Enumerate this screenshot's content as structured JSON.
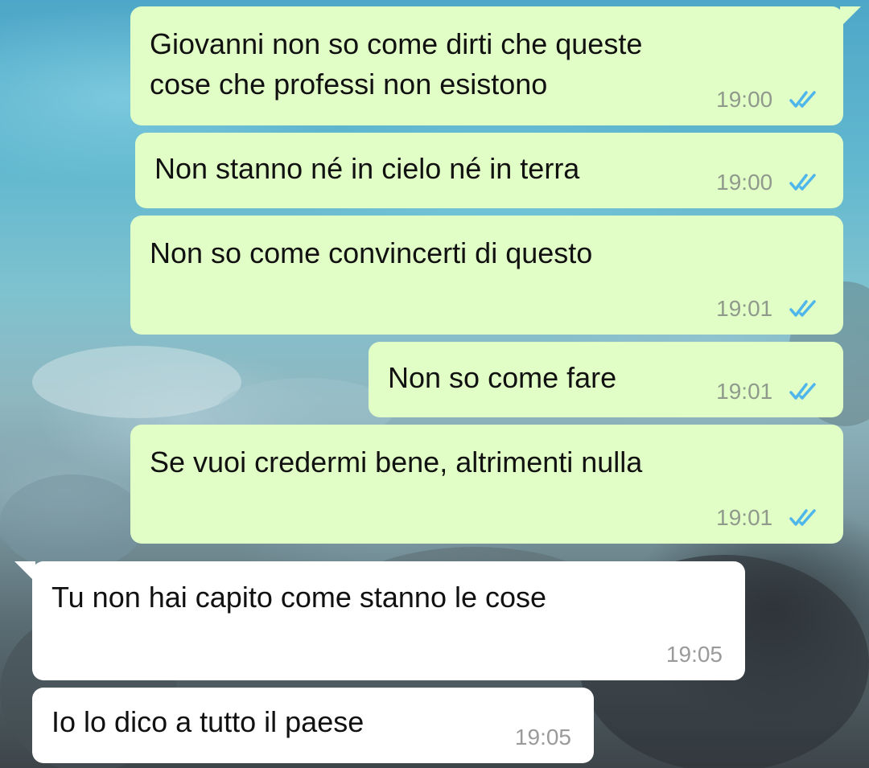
{
  "messages": [
    {
      "text": "Giovanni non so come dirti che queste\ncose che professi non esistono",
      "time": "19:00",
      "direction": "outgoing",
      "status": "read"
    },
    {
      "text": "Non stanno né in cielo né in terra",
      "time": "19:00",
      "direction": "outgoing",
      "status": "read"
    },
    {
      "text": "Non so come convincerti di questo",
      "time": "19:01",
      "direction": "outgoing",
      "status": "read"
    },
    {
      "text": "Non so come fare",
      "time": "19:01",
      "direction": "outgoing",
      "status": "read"
    },
    {
      "text": "Se vuoi credermi bene, altrimenti nulla",
      "time": "19:01",
      "direction": "outgoing",
      "status": "read"
    },
    {
      "text": "Tu non hai capito come stanno le cose",
      "time": "19:05",
      "direction": "incoming"
    },
    {
      "text": "Io lo dico a tutto il paese",
      "time": "19:05",
      "direction": "incoming"
    }
  ],
  "colors": {
    "outgoing_bubble": "#e1fec6",
    "incoming_bubble": "#ffffff",
    "read_ticks": "#4fb6ec",
    "timestamp": "#8f9a8c"
  },
  "icons": {
    "read_receipt": "double-check-icon"
  }
}
